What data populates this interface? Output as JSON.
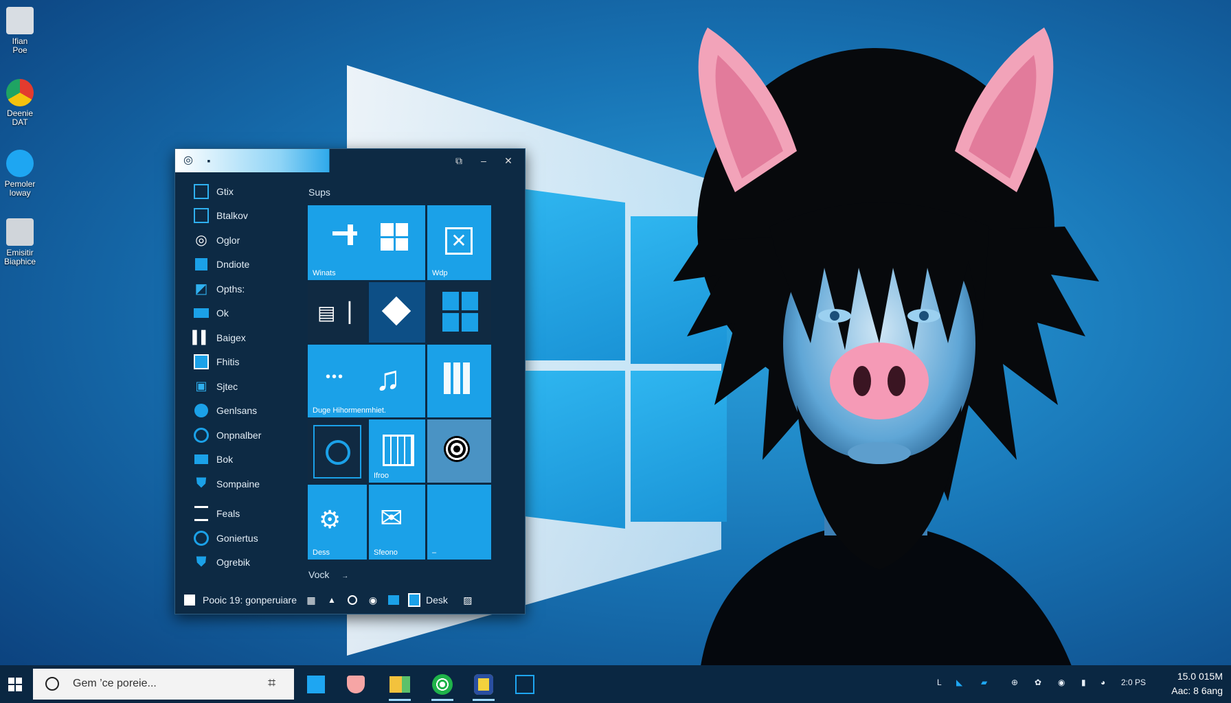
{
  "desktop": {
    "icons": [
      {
        "name": "desktop-icon-1",
        "label_l1": "Ifian",
        "label_l2": "Poe",
        "color": "#d8dde3"
      },
      {
        "name": "desktop-icon-chrome",
        "label_l1": "Deenie",
        "label_l2": "DAT",
        "color": "#e33b2e"
      },
      {
        "name": "desktop-icon-3",
        "label_l1": "Pemoler",
        "label_l2": "Ioway",
        "color": "#1ea6f2"
      },
      {
        "name": "desktop-icon-4",
        "label_l1": "Emisitir",
        "label_l2": "Biaphice",
        "color": "#d0d5da"
      }
    ]
  },
  "window": {
    "title": "▪",
    "title_icon": "circle-icon",
    "buttons": {
      "restore": "⧉",
      "minimize": "–",
      "close": "✕"
    },
    "left_items": [
      {
        "label": "Gtix",
        "icon": "square-icon"
      },
      {
        "label": "Btalkov",
        "icon": "square-icon"
      },
      {
        "label": "Oglor",
        "icon": "target-icon"
      },
      {
        "label": "Dndiote",
        "icon": "square-icon"
      },
      {
        "label": "Opths:",
        "icon": "tag-icon"
      },
      {
        "label": "Ok",
        "icon": "rect-icon"
      },
      {
        "label": "Baigex",
        "icon": "bars-icon"
      },
      {
        "label": "Fhitis",
        "icon": "square-icon"
      },
      {
        "label": "Sjtec",
        "icon": "bag-icon"
      },
      {
        "label": "Genlsans",
        "icon": "circle-icon"
      },
      {
        "label": "Onpnalber",
        "icon": "circle-icon"
      },
      {
        "label": "Bok",
        "icon": "rect-icon"
      },
      {
        "label": "Sompaine",
        "icon": "shield-icon"
      },
      {
        "label": "Feals",
        "icon": "rect-icon"
      },
      {
        "label": "Goniertus",
        "icon": "circle-icon"
      },
      {
        "label": "Ogrebik",
        "icon": "shield-icon"
      }
    ],
    "section_top": "Sups",
    "section_bottom": "Vock",
    "section_bottom_mark": "→",
    "tiles": {
      "t1_label": "Winats",
      "t2_label": "Wdp",
      "t7_label": "Duge Hihormenmhiet.",
      "t11_label": "Ifroo",
      "t13_label": "Dess",
      "t14_label": "Sfeono",
      "t15_label": "–"
    },
    "bottom": {
      "user_label": "Pooic 19: gonperuiare",
      "desk_label": "Desk"
    }
  },
  "taskbar": {
    "search_placeholder": "Gem ’ce poreie...",
    "apps": [
      {
        "name": "taskbar-app-store",
        "color": "#1ea6f2"
      },
      {
        "name": "taskbar-app-pocket",
        "color": "#f6a5a5"
      },
      {
        "name": "taskbar-app-files",
        "color": "#f3c23d"
      },
      {
        "name": "taskbar-app-green",
        "color": "#1fb34a"
      },
      {
        "name": "taskbar-app-badge",
        "color": "#f3d23d"
      },
      {
        "name": "taskbar-app-notes",
        "color": "#1ea6f2"
      }
    ],
    "tray_text": "2:0 PS",
    "clock_l1": "15.0 015M",
    "clock_l2": "Aac: 8 6ang"
  },
  "colors": {
    "accent": "#1ba1e8",
    "taskbar_bg": "#0a2742",
    "window_bg": "#0d2a44",
    "pig_pink": "#f59ab6"
  }
}
